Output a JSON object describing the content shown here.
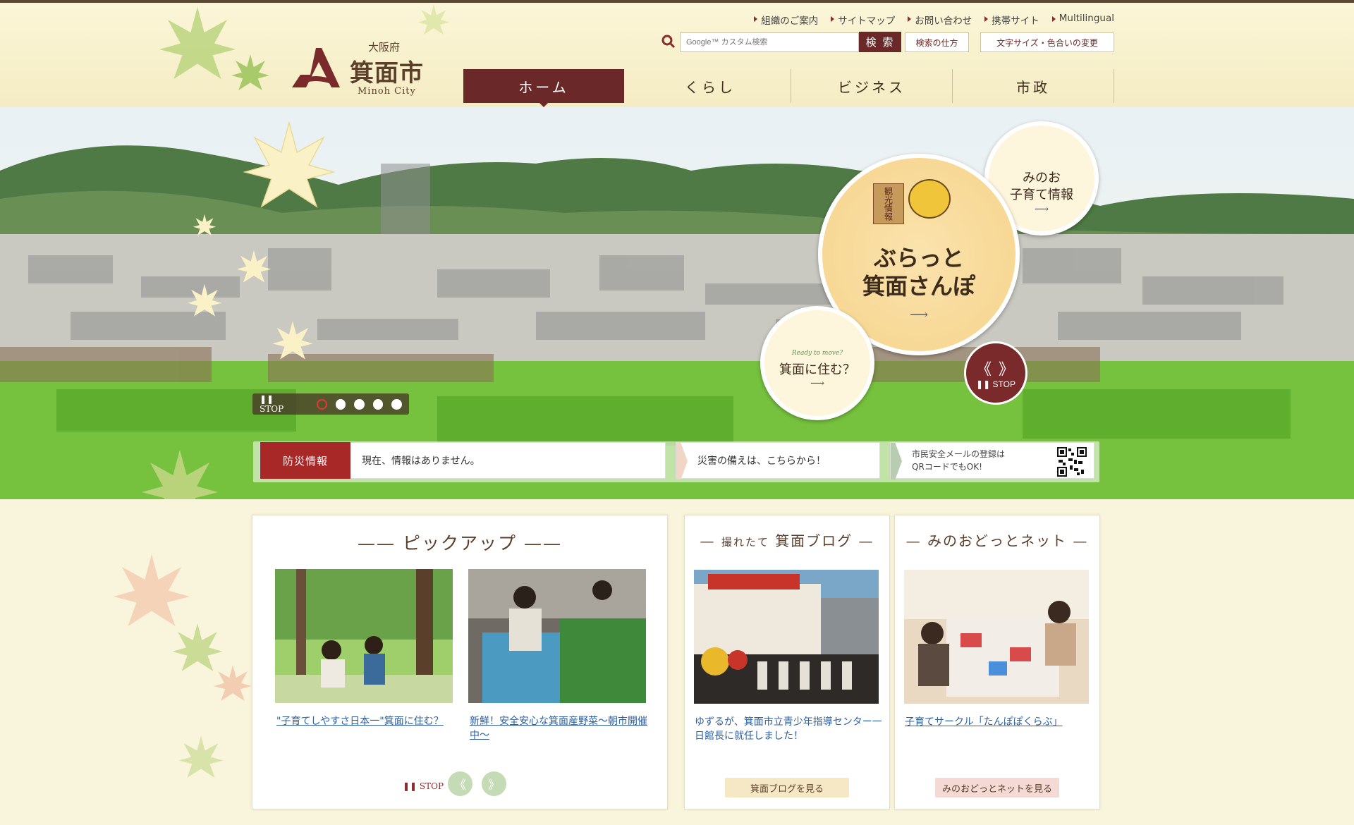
{
  "header": {
    "logo": {
      "prefecture": "大阪府",
      "city": "箕面市",
      "english": "Minoh City"
    },
    "utility_links": [
      "組織のご案内",
      "サイトマップ",
      "お問い合わせ",
      "携帯サイト",
      "Multilingual"
    ],
    "search": {
      "placeholder": "Google™ カスタム検索",
      "button_label": "検 索"
    },
    "help_label": "検索の仕方",
    "fontsize_label": "文字サイズ・色合いの変更"
  },
  "nav": {
    "tabs": [
      {
        "label": "ホーム",
        "active": true
      },
      {
        "label": "くらし",
        "active": false
      },
      {
        "label": "ビジネス",
        "active": false
      },
      {
        "label": "市政",
        "active": false
      }
    ]
  },
  "hero": {
    "main_bubble": {
      "badge": "観光情報",
      "title_line1": "ぶらっと",
      "title_line2": "箕面さんぽ",
      "arrow": "⟶"
    },
    "kids_bubble": {
      "title_line1": "みのお",
      "title_line2": "子育て情報",
      "arrow": "⟶"
    },
    "live_bubble": {
      "subtitle": "Ready to move?",
      "title": "箕面に住む？",
      "arrow": "⟶"
    },
    "stop_button": {
      "arrows": "《 》",
      "label": "❚❚ STOP"
    },
    "slider": {
      "stop_label": "❚❚ STOP",
      "dots": 5,
      "active_index": 0
    }
  },
  "info": {
    "disaster_label": "防災情報",
    "disaster_text": "現在、情報はありません。",
    "prep_text": "災害の備えは、こちらから！",
    "mail_text_line1": "市民安全メールの登録は",
    "mail_text_line2": "QRコードでもOK!"
  },
  "pickup": {
    "title": "ピックアップ",
    "items": [
      {
        "caption": "\"子育てしやすさ日本一\"箕面に住む？"
      },
      {
        "caption": "新鮮！安全安心な箕面産野菜～朝市開催中～"
      }
    ],
    "stop_label": "❚❚ STOP",
    "prev_label": "《",
    "next_label": "》"
  },
  "blog": {
    "title_small": "撮れたて",
    "title": "箕面ブログ",
    "caption": "ゆずるが、箕面市立青少年指導センター一日館長に就任しました！",
    "more_label": "箕面ブログを見る"
  },
  "dotnet": {
    "title": "みのおどっとネット",
    "caption": "子育てサークル「たんぽぽくらぶ」",
    "more_label": "みのおどっとネットを見る"
  },
  "colors": {
    "accent": "#6b2828",
    "disaster": "#a82727",
    "background": "#f9f4dc",
    "link": "#2d5fa3"
  },
  "icons": [
    "maple-leaf-icon",
    "search-icon",
    "qr-code-icon",
    "prev-chevron-icon",
    "next-chevron-icon"
  ]
}
